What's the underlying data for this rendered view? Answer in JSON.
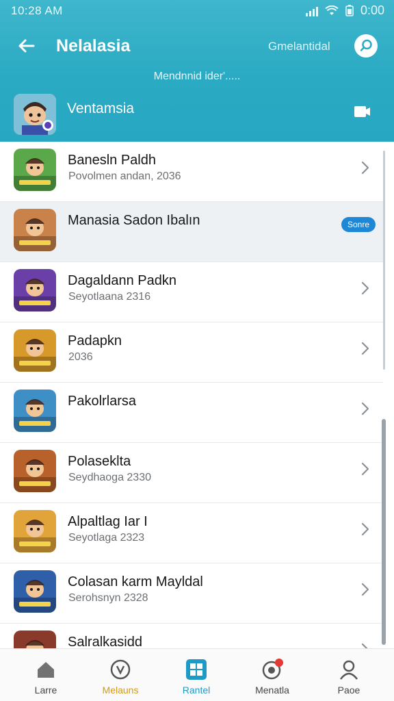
{
  "status_bar": {
    "time": "10:28 AM",
    "clock": "0:00"
  },
  "header": {
    "back_icon": "arrow-left-icon",
    "title": "Nelalasia",
    "link_label": "Gmelantidal",
    "search_icon": "search-icon",
    "subtitle": "Mendnnid ider'.....",
    "featured": {
      "name": "Ventamsia",
      "action_icon": "message-icon"
    }
  },
  "list": {
    "items": [
      {
        "name": "Banesln Paldh",
        "meta": "Povolmen andan, 2036",
        "thumb_color": "#5aa84a",
        "selected": false
      },
      {
        "name": "Manasia Sadon Ibalın",
        "meta": "",
        "thumb_color": "#c9824a",
        "selected": true,
        "badge": "Sonre"
      },
      {
        "name": "Dagaldann Padkn",
        "meta": "Seyotlaana 2316",
        "thumb_color": "#6a3fa8",
        "selected": false
      },
      {
        "name": "Padapkn",
        "meta": "2036",
        "thumb_color": "#d79a2a",
        "selected": false
      },
      {
        "name": "Pakolrlarsa",
        "meta": "",
        "thumb_color": "#3f8fc7",
        "selected": false
      },
      {
        "name": "Polaseklta",
        "meta": "Seydhaoga 2330",
        "thumb_color": "#b8612a",
        "selected": false
      },
      {
        "name": "Alpaltlag Iar I",
        "meta": "Seyotlaga 2323",
        "thumb_color": "#e0a43a",
        "selected": false
      },
      {
        "name": "Colasan karm Mayldal",
        "meta": "Serohsnyn 2328",
        "thumb_color": "#2f5fa8",
        "selected": false
      },
      {
        "name": "Salralkasidd",
        "meta": "",
        "thumb_color": "#8a3a2a",
        "selected": false
      }
    ]
  },
  "bottom_nav": {
    "items": [
      {
        "label": "Larre",
        "icon": "home-icon",
        "color": "#444444"
      },
      {
        "label": "Melauns",
        "icon": "compass-icon",
        "color": "#d39a12"
      },
      {
        "label": "Rantel",
        "icon": "grid-icon",
        "color": "#1f9ac4"
      },
      {
        "label": "Menatla",
        "icon": "notification-icon",
        "color": "#444444"
      },
      {
        "label": "Paoe",
        "icon": "profile-icon",
        "color": "#444444"
      }
    ]
  },
  "colors": {
    "header_bg": "#2aaac3",
    "accent_blue": "#1f88d6",
    "nav_active": "#1f9ac4"
  }
}
